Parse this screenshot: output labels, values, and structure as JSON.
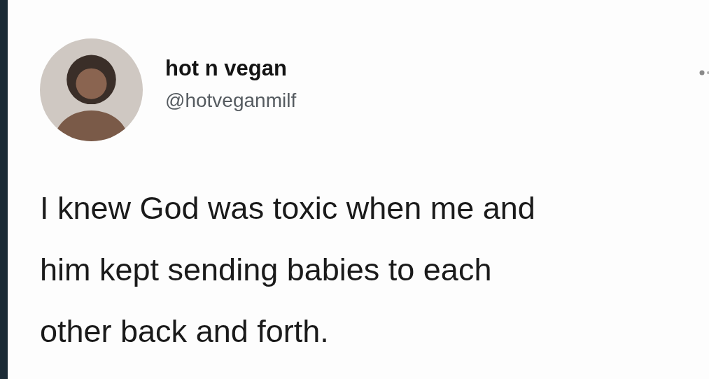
{
  "tweet": {
    "display_name": "hot n vegan",
    "handle": "@hotveganmilf",
    "text_lines": [
      "I knew God was toxic when me and",
      "him kept sending babies to each",
      "other back and forth."
    ]
  }
}
